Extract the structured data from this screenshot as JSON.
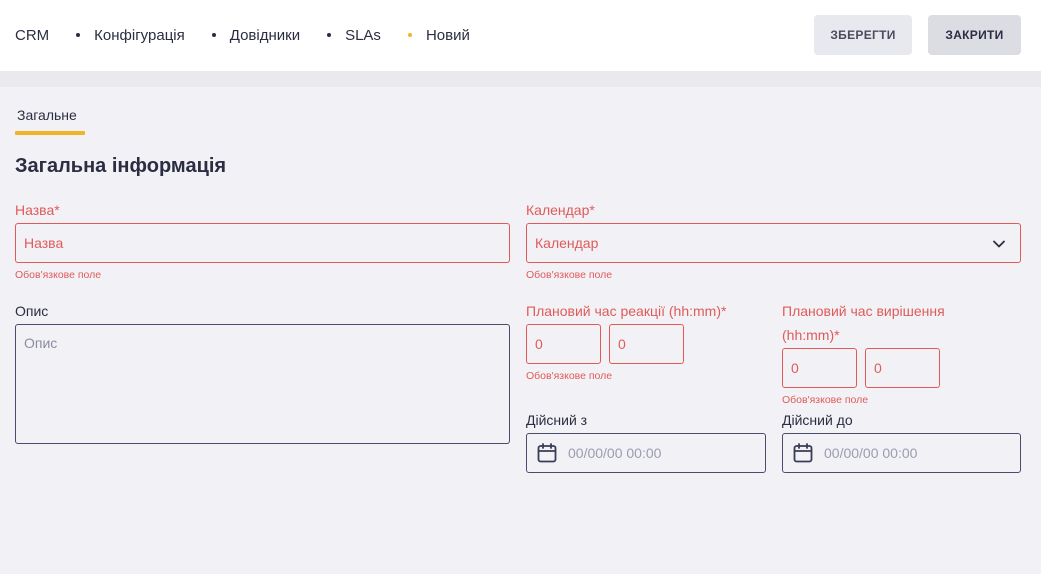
{
  "breadcrumb": {
    "items": [
      "CRM",
      "Конфігурація",
      "Довідники",
      "SLAs",
      "Новий"
    ]
  },
  "toolbar": {
    "save_label": "ЗБЕРЕГТИ",
    "close_label": "ЗАКРИТИ"
  },
  "tabs": [
    {
      "label": "Загальне",
      "active": true
    }
  ],
  "section": {
    "title": "Загальна інформація"
  },
  "form": {
    "name": {
      "label": "Назва*",
      "placeholder": "Назва",
      "hint": "Обов'язкове поле"
    },
    "calendar": {
      "label": "Календар*",
      "value": "Календар",
      "hint": "Обов'язкове поле"
    },
    "description": {
      "label": "Опис",
      "placeholder": "Опис"
    },
    "reaction_time": {
      "label": "Плановий час реакції (hh:mm)*",
      "hours": "0",
      "minutes": "0",
      "hint": "Обов'язкове поле"
    },
    "resolution_time": {
      "label_line1": "Плановий час вирішення",
      "label_line2": "(hh:mm)*",
      "hours": "0",
      "minutes": "0",
      "hint": "Обов'язкове поле"
    },
    "valid_from": {
      "label": "Дійсний з",
      "placeholder": "00/00/00 00:00"
    },
    "valid_to": {
      "label": "Дійсний до",
      "placeholder": "00/00/00 00:00"
    }
  },
  "colors": {
    "accent": "#f0b429",
    "error": "#e05a5a",
    "text": "#2b2d42",
    "background": "#f2f2f6"
  },
  "icons": {
    "calendar_select": "chevron-down-icon",
    "date": "calendar-icon"
  }
}
